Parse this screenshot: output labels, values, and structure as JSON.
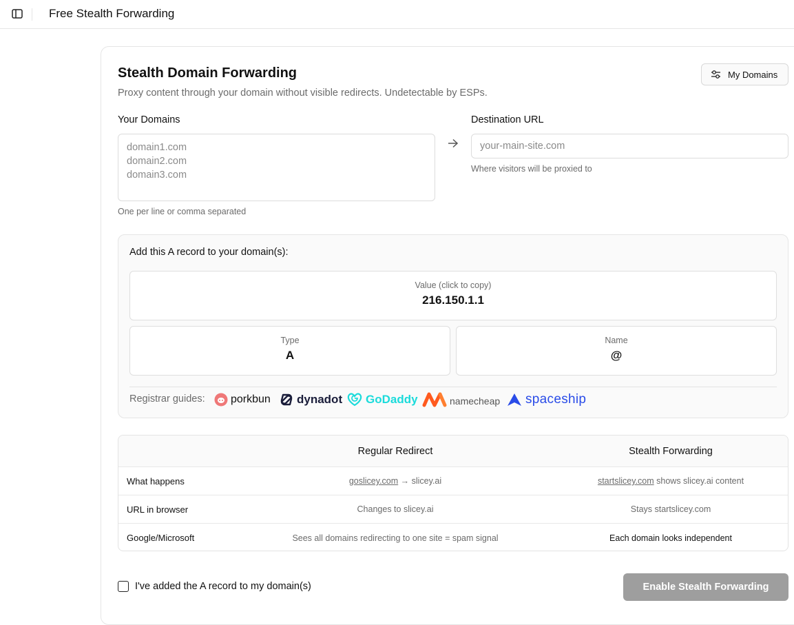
{
  "app": {
    "title": "Free Stealth Forwarding"
  },
  "header": {
    "title": "Stealth Domain Forwarding",
    "subtitle": "Proxy content through your domain without visible redirects. Undetectable by ESPs.",
    "my_domains_label": "My Domains"
  },
  "form": {
    "domains_label": "Your Domains",
    "domains_placeholder": "domain1.com\ndomain2.com\ndomain3.com",
    "domains_hint": "One per line or comma separated",
    "destination_label": "Destination URL",
    "destination_placeholder": "your-main-site.com",
    "destination_hint": "Where visitors will be proxied to"
  },
  "record": {
    "heading": "Add this A record to your domain(s):",
    "value_caption": "Value (click to copy)",
    "value": "216.150.1.1",
    "type_caption": "Type",
    "type": "A",
    "name_caption": "Name",
    "name": "@",
    "registrar_label": "Registrar guides:",
    "registrars": [
      "porkbun",
      "dynadot",
      "GoDaddy",
      "namecheap",
      "spaceship"
    ]
  },
  "comparison": {
    "headers": [
      "",
      "Regular Redirect",
      "Stealth Forwarding"
    ],
    "rows": [
      {
        "label": "What happens",
        "regular_link": "goslicey.com",
        "regular_rest": " → slicey.ai",
        "stealth_link": "startslicey.com",
        "stealth_rest": " shows slicey.ai content"
      },
      {
        "label": "URL in browser",
        "regular": "Changes to slicey.ai",
        "stealth": "Stays startslicey.com"
      },
      {
        "label": "Google/Microsoft",
        "regular": "Sees all domains redirecting to one site = spam signal",
        "stealth": "Each domain looks independent"
      }
    ]
  },
  "footer": {
    "confirm_label": "I've added the A record to my domain(s)",
    "confirm_checked": false,
    "enable_label": "Enable Stealth Forwarding"
  },
  "colors": {
    "godaddy": "#1bdbdb",
    "spaceship": "#2a4ce8",
    "namecheap": "#ff5a1f",
    "porkbun": "#ef7878",
    "disabled_button": "#9e9e9e"
  },
  "icons": {
    "sidebar_toggle": "sidebar-panel-icon",
    "my_domains": "sliders-icon",
    "arrow": "arrow-right-icon"
  }
}
